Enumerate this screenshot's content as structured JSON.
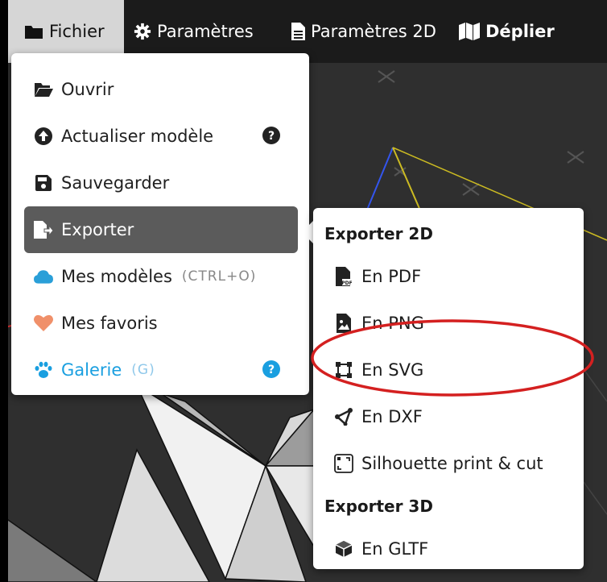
{
  "menubar": {
    "items": [
      {
        "label": "Fichier",
        "icon": "folder-icon"
      },
      {
        "label": "Paramètres",
        "icon": "gear-icon"
      },
      {
        "label": "Paramètres 2D",
        "icon": "document-icon"
      },
      {
        "label": "Déplier",
        "icon": "map-icon"
      }
    ]
  },
  "file_menu": {
    "items": [
      {
        "label": "Ouvrir",
        "icon": "open-folder-icon"
      },
      {
        "label": "Actualiser modèle",
        "icon": "upload-circle-icon",
        "help": "question-circle-icon"
      },
      {
        "label": "Sauvegarder",
        "icon": "floppy-disk-icon"
      },
      {
        "label": "Exporter",
        "icon": "file-export-icon",
        "selected": true
      },
      {
        "label": "Mes modèles",
        "shortcut": "(CTRL+O)",
        "icon": "cloud-icon",
        "icon_color": "#2a9fd8"
      },
      {
        "label": "Mes favoris",
        "icon": "heart-icon",
        "icon_color": "#f0906a"
      },
      {
        "label": "Galerie",
        "shortcut": "(G)",
        "icon": "paw-icon",
        "icon_color": "#1a9fe0",
        "help": "question-circle-icon"
      }
    ]
  },
  "export_submenu": {
    "header_2d": "Exporter 2D",
    "items_2d": [
      {
        "label": "En PDF",
        "icon": "pdf-file-icon"
      },
      {
        "label": "En PNG",
        "icon": "image-file-icon"
      },
      {
        "label": "En SVG",
        "icon": "vector-square-icon"
      },
      {
        "label": "En DXF",
        "icon": "draw-polygon-icon"
      },
      {
        "label": "Silhouette print & cut",
        "icon": "print-cut-frame-icon"
      }
    ],
    "header_3d": "Exporter 3D",
    "items_3d": [
      {
        "label": "En GLTF",
        "icon": "cube-icon"
      }
    ]
  },
  "colors": {
    "menubar_bg": "#1b1b1b",
    "active_tab_bg": "#d6d6d6",
    "selected_item_bg": "#5b5b5b",
    "accent_blue": "#1a9fe0",
    "annotation_red": "#d42020"
  }
}
